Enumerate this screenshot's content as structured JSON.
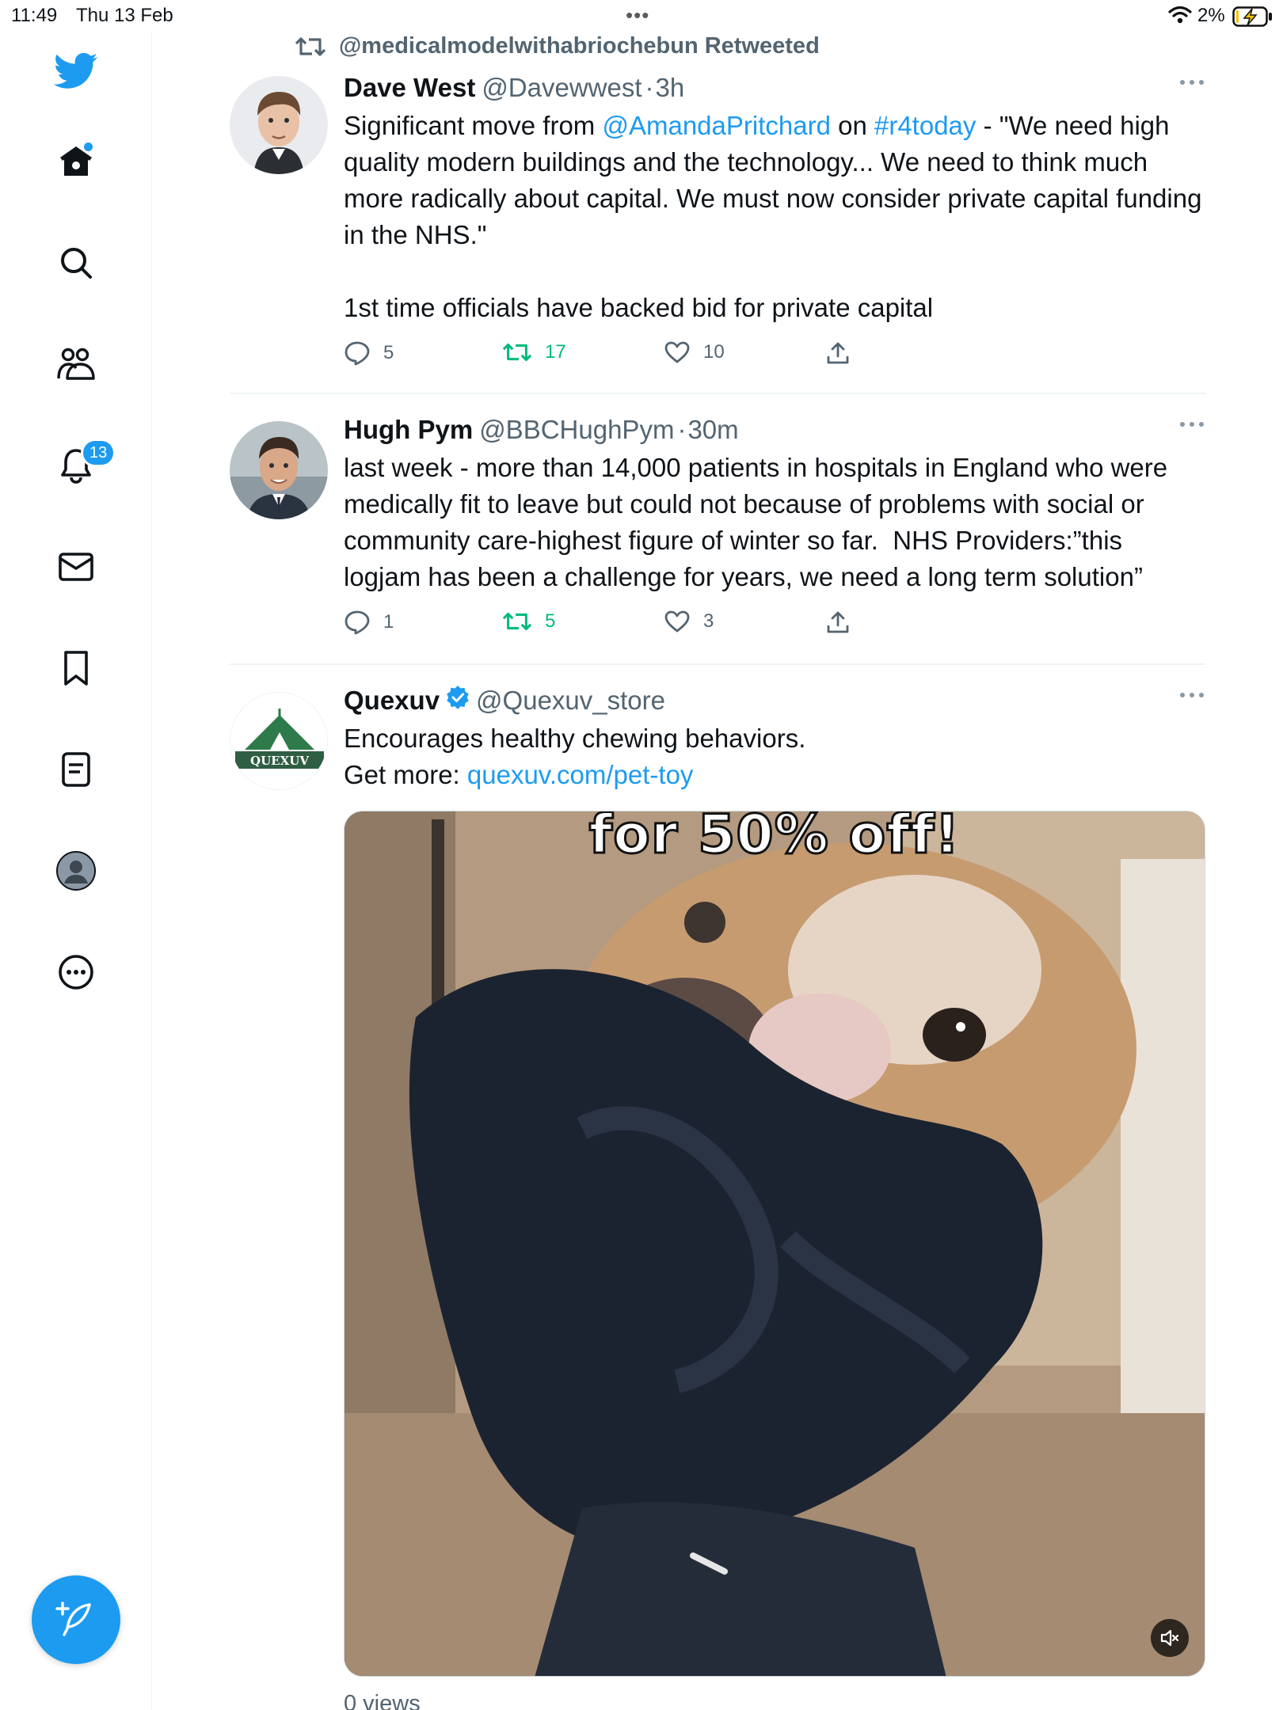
{
  "status_bar": {
    "time": "11:49",
    "date": "Thu 13 Feb",
    "battery_percent": "2%"
  },
  "sidebar": {
    "items": [
      {
        "name": "twitter-logo-icon"
      },
      {
        "name": "home-icon",
        "has_dot": true
      },
      {
        "name": "search-icon"
      },
      {
        "name": "communities-icon"
      },
      {
        "name": "notifications-icon",
        "badge": "13"
      },
      {
        "name": "messages-icon"
      },
      {
        "name": "bookmarks-icon"
      },
      {
        "name": "lists-icon"
      },
      {
        "name": "profile-icon"
      },
      {
        "name": "more-icon"
      }
    ],
    "compose_icon": "compose-feather-icon"
  },
  "colors": {
    "accent": "#1d9bf0",
    "secondary_text": "#536471",
    "retweet_green": "#00ba7c",
    "divider": "#eff3f4"
  },
  "timeline": {
    "tweets": [
      {
        "retweet_context": "@medicalmodelwithabriochebun Retweeted",
        "display_name": "Dave West",
        "handle": "@Davewwest",
        "sep": "·",
        "time": "3h",
        "text_lines": {
          "mention": "@AmandaPritchard",
          "hashtag": "#r4today",
          "part1": "Significant move from ",
          "part2": " on ",
          "part3": " - \"We need high quality modern buildings and the technology... We need to think much more radically about capital. We must now consider private capital funding in the NHS.\"\n\n1st time officials have backed bid for private capital"
        },
        "replies": "5",
        "retweets": "17",
        "likes": "10"
      },
      {
        "display_name": "Hugh Pym",
        "handle": "@BBCHughPym",
        "sep": "·",
        "time": "30m",
        "text": "last week - more than 14,000 patients in hospitals in England who were medically fit to leave but could not because of problems with social or community care-highest figure of winter so far.  NHS Providers:”this logjam has been a challenge for years, we need a long term solution”",
        "replies": "1",
        "retweets": "5",
        "likes": "3"
      },
      {
        "display_name": "Quexuv",
        "handle": "@Quexuv_store",
        "verified": true,
        "avatar_text": "QUEXUV",
        "text_line1": "Encourages healthy chewing behaviors.",
        "text_line2_prefix": "Get more: ",
        "link": "quexuv.com/pet-toy",
        "media_caption": "for 50% off!",
        "views": "0 views"
      }
    ]
  }
}
